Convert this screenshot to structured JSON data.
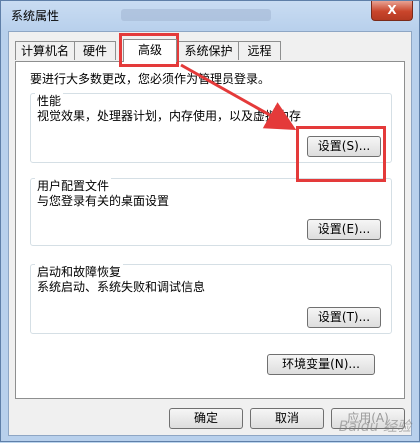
{
  "window": {
    "title": "系统属性",
    "close_label": "X"
  },
  "tabs": [
    {
      "label": "计算机名"
    },
    {
      "label": "硬件"
    },
    {
      "label": "高级",
      "active": true
    },
    {
      "label": "系统保护"
    },
    {
      "label": "远程"
    }
  ],
  "panel": {
    "intro": "要进行大多数更改，您必须作为管理员登录。",
    "performance": {
      "title": "性能",
      "desc": "视觉效果，处理器计划，内存使用，以及虚拟内存",
      "button": "设置(S)..."
    },
    "profile": {
      "title": "用户配置文件",
      "desc": "与您登录有关的桌面设置",
      "button": "设置(E)..."
    },
    "startup": {
      "title": "启动和故障恢复",
      "desc": "系统启动、系统失败和调试信息",
      "button": "设置(T)..."
    },
    "env_button": "环境变量(N)..."
  },
  "footer": {
    "ok": "确定",
    "cancel": "取消",
    "apply": "应用(A)"
  },
  "watermark": "Baidu 经验",
  "colors": {
    "highlight": "#e43a3a",
    "title_bar": "#c9dcf2",
    "close_button": "#c9452b"
  }
}
